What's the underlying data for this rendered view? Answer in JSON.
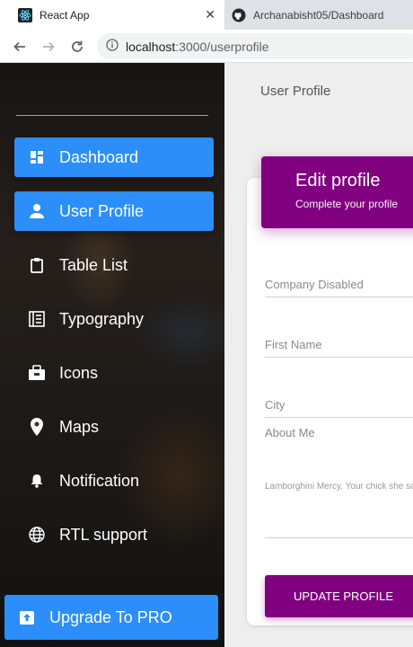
{
  "browser": {
    "tabs": [
      {
        "title": "React App",
        "icon": "react-icon",
        "active": true
      },
      {
        "title": "Archanabisht05/Dashboard",
        "icon": "github-icon",
        "active": false
      }
    ],
    "tab_close": "✕",
    "url_host": "localhost",
    "url_path": ":3000/userprofile"
  },
  "sidebar": {
    "items": [
      {
        "label": "Dashboard",
        "icon": "dashboard-icon",
        "active": true
      },
      {
        "label": "User Profile",
        "icon": "person-icon",
        "active": true
      },
      {
        "label": "Table List",
        "icon": "clipboard-icon",
        "active": false
      },
      {
        "label": "Typography",
        "icon": "library-books-icon",
        "active": false
      },
      {
        "label": "Icons",
        "icon": "bubble-chart-icon",
        "active": false
      },
      {
        "label": "Maps",
        "icon": "location-pin-icon",
        "active": false
      },
      {
        "label": "Notification",
        "icon": "bell-icon",
        "active": false
      },
      {
        "label": "RTL support",
        "icon": "language-icon",
        "active": false
      }
    ],
    "upgrade_label": "Upgrade To PRO",
    "accent": "#2c8ef8"
  },
  "main": {
    "page_title": "User Profile",
    "card": {
      "title": "Edit profile",
      "subtitle": "Complete your profile",
      "header_color": "#800080"
    },
    "fields": {
      "company": "Company Disabled",
      "first_name": "First Name",
      "city": "City",
      "about_label": "About Me",
      "about_text": "Lamborghini Mercy, Your chick she so thirsty"
    },
    "update_button": "UPDATE PROFILE"
  }
}
